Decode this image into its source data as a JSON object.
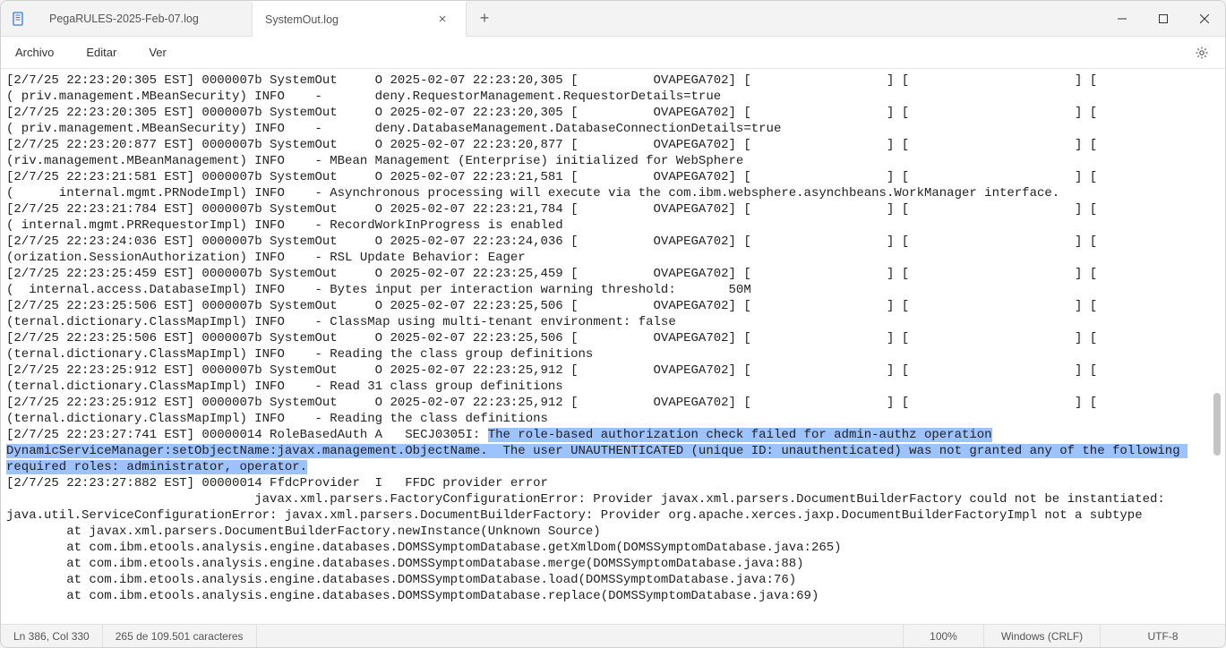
{
  "tabs": [
    {
      "label": "PegaRULES-2025-Feb-07.log",
      "active": false
    },
    {
      "label": "SystemOut.log",
      "active": true
    }
  ],
  "menus": {
    "file": "Archivo",
    "edit": "Editar",
    "view": "Ver"
  },
  "selection": {
    "text_pre": "The role-based authorization check failed for admin-authz operation",
    "text_line2": "DynamicServiceManager:setObjectName:javax.management.ObjectName.  The user UNAUTHENTICATED (unique ID: unauthenticated) was not granted any of the following ",
    "text_line3": "required roles: administrator, operator."
  },
  "log_lines": [
    "[2/7/25 22:23:20:305 EST] 0000007b SystemOut     O 2025-02-07 22:23:20,305 [          OVAPEGA702] [                  ] [                      ] [                          ]",
    "( priv.management.MBeanSecurity) INFO    -       deny.RequestorManagement.RequestorDetails=true",
    "[2/7/25 22:23:20:305 EST] 0000007b SystemOut     O 2025-02-07 22:23:20,305 [          OVAPEGA702] [                  ] [                      ] [                          ]",
    "( priv.management.MBeanSecurity) INFO    -       deny.DatabaseManagement.DatabaseConnectionDetails=true",
    "[2/7/25 22:23:20:877 EST] 0000007b SystemOut     O 2025-02-07 22:23:20,877 [          OVAPEGA702] [                  ] [                      ] [                          ]",
    "(riv.management.MBeanManagement) INFO    - MBean Management (Enterprise) initialized for WebSphere",
    "[2/7/25 22:23:21:581 EST] 0000007b SystemOut     O 2025-02-07 22:23:21,581 [          OVAPEGA702] [                  ] [                      ] [                          ]",
    "(      internal.mgmt.PRNodeImpl) INFO    - Asynchronous processing will execute via the com.ibm.websphere.asynchbeans.WorkManager interface.",
    "[2/7/25 22:23:21:784 EST] 0000007b SystemOut     O 2025-02-07 22:23:21,784 [          OVAPEGA702] [                  ] [                      ] [                          ]",
    "( internal.mgmt.PRRequestorImpl) INFO    - RecordWorkInProgress is enabled",
    "[2/7/25 22:23:24:036 EST] 0000007b SystemOut     O 2025-02-07 22:23:24,036 [          OVAPEGA702] [                  ] [                      ] [                          ]",
    "(orization.SessionAuthorization) INFO    - RSL Update Behavior: Eager",
    "[2/7/25 22:23:25:459 EST] 0000007b SystemOut     O 2025-02-07 22:23:25,459 [          OVAPEGA702] [                  ] [                      ] [                          ]",
    "(  internal.access.DatabaseImpl) INFO    - Bytes input per interaction warning threshold:       50M",
    "[2/7/25 22:23:25:506 EST] 0000007b SystemOut     O 2025-02-07 22:23:25,506 [          OVAPEGA702] [                  ] [                      ] [                          ]",
    "(ternal.dictionary.ClassMapImpl) INFO    - ClassMap using multi-tenant environment: false",
    "[2/7/25 22:23:25:506 EST] 0000007b SystemOut     O 2025-02-07 22:23:25,506 [          OVAPEGA702] [                  ] [                      ] [                          ]",
    "(ternal.dictionary.ClassMapImpl) INFO    - Reading the class group definitions",
    "[2/7/25 22:23:25:912 EST] 0000007b SystemOut     O 2025-02-07 22:23:25,912 [          OVAPEGA702] [                  ] [                      ] [                          ]",
    "(ternal.dictionary.ClassMapImpl) INFO    - Read 31 class group definitions",
    "[2/7/25 22:23:25:912 EST] 0000007b SystemOut     O 2025-02-07 22:23:25,912 [          OVAPEGA702] [                  ] [                      ] [                          ]",
    "(ternal.dictionary.ClassMapImpl) INFO    - Reading the class definitions",
    "[2/7/25 22:23:27:741 EST] 00000014 RoleBasedAuth A   SECJ0305I: ",
    "",
    "",
    "[2/7/25 22:23:27:882 EST] 00000014 FfdcProvider  I   FFDC provider error",
    "                                 javax.xml.parsers.FactoryConfigurationError: Provider javax.xml.parsers.DocumentBuilderFactory could not be instantiated:",
    "java.util.ServiceConfigurationError: javax.xml.parsers.DocumentBuilderFactory: Provider org.apache.xerces.jaxp.DocumentBuilderFactoryImpl not a subtype",
    "        at javax.xml.parsers.DocumentBuilderFactory.newInstance(Unknown Source)",
    "        at com.ibm.etools.analysis.engine.databases.DOMSSymptomDatabase.getXmlDom(DOMSSymptomDatabase.java:265)",
    "        at com.ibm.etools.analysis.engine.databases.DOMSSymptomDatabase.merge(DOMSSymptomDatabase.java:88)",
    "        at com.ibm.etools.analysis.engine.databases.DOMSSymptomDatabase.load(DOMSSymptomDatabase.java:76)",
    "        at com.ibm.etools.analysis.engine.databases.DOMSSymptomDatabase.replace(DOMSSymptomDatabase.java:69)"
  ],
  "status": {
    "position": "Ln 386, Col 330",
    "selection": "265 de 109.501 caracteres",
    "zoom": "100%",
    "eol": "Windows (CRLF)",
    "encoding": "UTF-8"
  }
}
